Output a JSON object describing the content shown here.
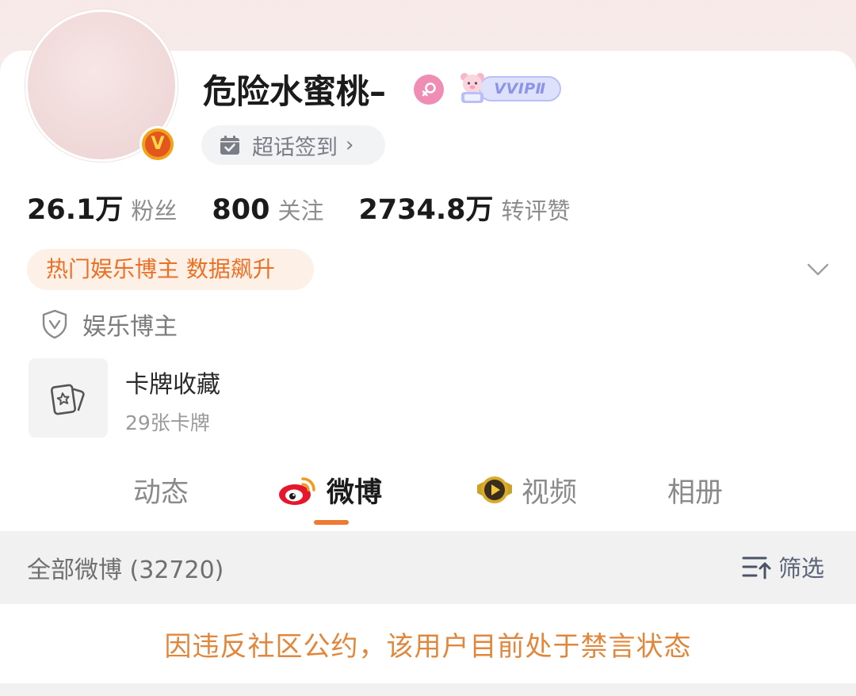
{
  "profile": {
    "username": "危险水蜜桃–",
    "verified_badge": "V",
    "vip_badge": "VVIPⅡ",
    "checkin_label": "超话签到",
    "checkin_arrow": "›"
  },
  "stats": [
    {
      "value": "26.1万",
      "label": "粉丝"
    },
    {
      "value": "800",
      "label": "关注"
    },
    {
      "value": "2734.8万",
      "label": "转评赞"
    }
  ],
  "hot_tag": "热门娱乐博主 数据飙升",
  "role": {
    "label": "娱乐博主",
    "icon": "shield-v-icon"
  },
  "card_collection": {
    "title": "卡牌收藏",
    "subtitle": "29张卡牌"
  },
  "tabs": [
    {
      "label": "动态",
      "active": false
    },
    {
      "label": "微博",
      "active": true,
      "icon": "weibo-logo-icon"
    },
    {
      "label": "视频",
      "active": false,
      "icon": "video-badge-icon"
    },
    {
      "label": "相册",
      "active": false
    }
  ],
  "feed": {
    "title": "全部微博 (32720)",
    "filter_label": "筛选"
  },
  "notice": "因违反社区公约，该用户目前处于禁言状态",
  "colors": {
    "accent": "#ee7b33",
    "hot_tag_text": "#ec6f24",
    "notice_text": "#e0873b",
    "gender": "#f08db4",
    "vip": "#8b94e8"
  }
}
